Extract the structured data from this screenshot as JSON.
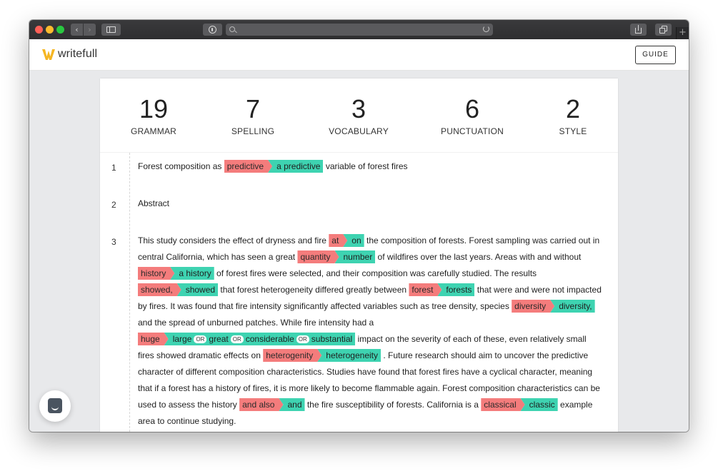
{
  "browser": {
    "nav_back": "‹",
    "nav_forward": "›",
    "new_tab": "+"
  },
  "app": {
    "logo_text": "writefull",
    "brand_color": "#f5b623",
    "guide_label": "GUIDE"
  },
  "stats": [
    {
      "count": "19",
      "label": "GRAMMAR"
    },
    {
      "count": "7",
      "label": "SPELLING"
    },
    {
      "count": "3",
      "label": "VOCABULARY"
    },
    {
      "count": "6",
      "label": "PUNCTUATION"
    },
    {
      "count": "2",
      "label": "STYLE"
    }
  ],
  "colors": {
    "error": "#f47c7c",
    "suggestion": "#3ed3b1"
  },
  "paragraphs": {
    "p1": {
      "num": "1",
      "t1": "Forest composition as",
      "err1": "predictive",
      "fix1": "a predictive",
      "t2": "variable of forest fires"
    },
    "p2": {
      "num": "2",
      "text": "Abstract"
    },
    "p3": {
      "num": "3",
      "l1_t1": "This study considers the effect of dryness and fire",
      "l1_err": "at",
      "l1_fix": "on",
      "l1_t2": "the composition of forests. Forest sampling was carried out in",
      "l2_t1": "central California, which has seen a great",
      "l2_err": "quantity",
      "l2_fix": "number",
      "l2_t2": "of wildfires over the last years. Areas with and without",
      "l3_err": "history",
      "l3_fix": "a history",
      "l3_t1": "of forest fires were selected, and their composition was carefully studied. The results",
      "l4_err": "showed,",
      "l4_fix": "showed",
      "l4_t1": "that forest heterogeneity differed greatly between",
      "l4_err2": "forest",
      "l4_fix2": "forests",
      "l4_t2": "that were and were not impacted",
      "l5_t1": "by fires. It was found that fire intensity significantly affected variables such as tree density, species",
      "l5_err": "diversity",
      "l5_fix": "diversity,",
      "l6_t1": "and the spread of unburned patches. While fire intensity had a",
      "l7_err": "huge",
      "l7_opt1": "large",
      "l7_or": "OR",
      "l7_opt2": "great",
      "l7_opt3": "considerable",
      "l7_opt4": "substantial",
      "l7_t1": "impact on the severity of each of these, even relatively small",
      "l8_t1": "fires showed dramatic effects on",
      "l8_err": "heterogenity",
      "l8_fix": "heterogeneity",
      "l8_t2": ". Future research should aim to uncover the predictive",
      "l9_t1": "character of different composition characteristics. Studies have found that forest fires have a cyclical character, meaning",
      "l10_t1": "that if a forest has a history of fires, it is more likely to become flammable again. Forest composition characteristics can be",
      "l11_t1": "used to assess the history",
      "l11_err": "and also",
      "l11_fix": "and",
      "l11_t2": "the fire susceptibility of forests. California is a",
      "l11_err2": "classical",
      "l11_fix2": "classic",
      "l11_t3": "example",
      "l12_t1": "area to continue studying."
    }
  }
}
